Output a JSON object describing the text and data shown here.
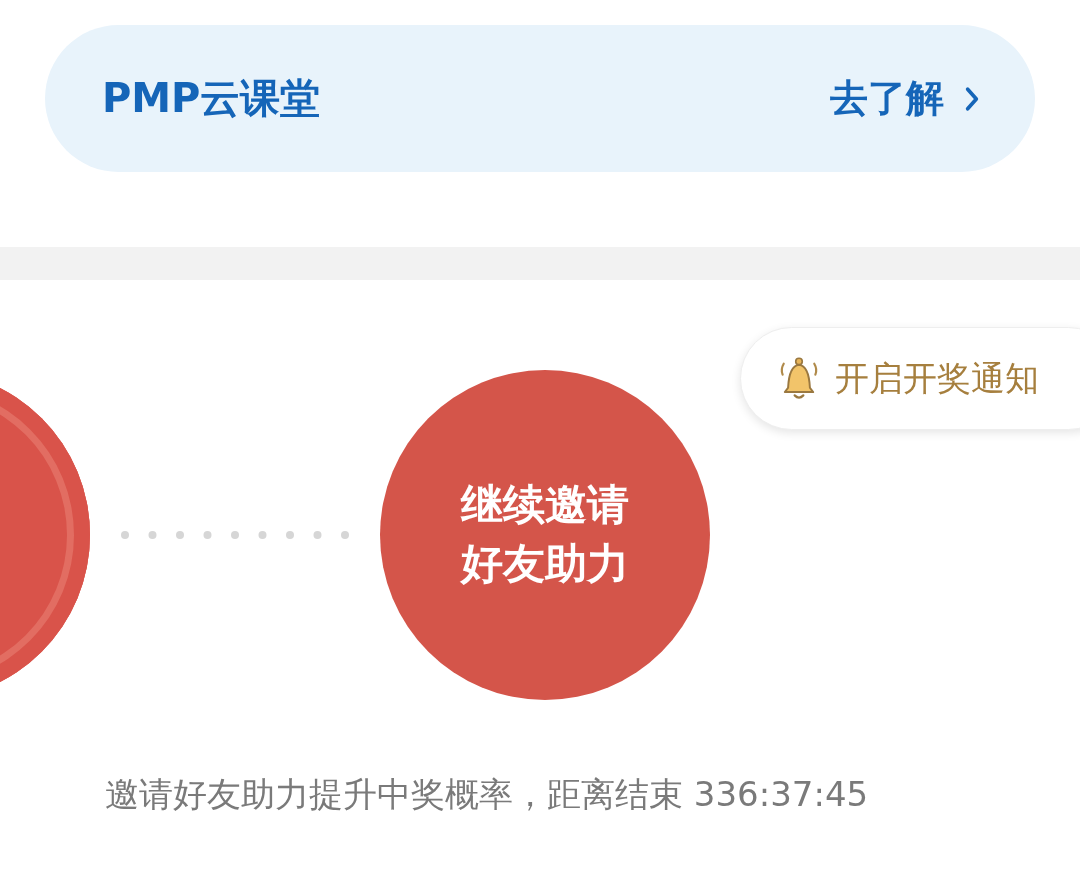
{
  "banner": {
    "title": "PMP云课堂",
    "link": "去了解"
  },
  "notify_button": {
    "label": "开启开奖通知"
  },
  "progress": {
    "action_label": "继续邀请好友助力"
  },
  "footer_text": "邀请好友助力提升中奖概率，距离结束 336:37:45"
}
